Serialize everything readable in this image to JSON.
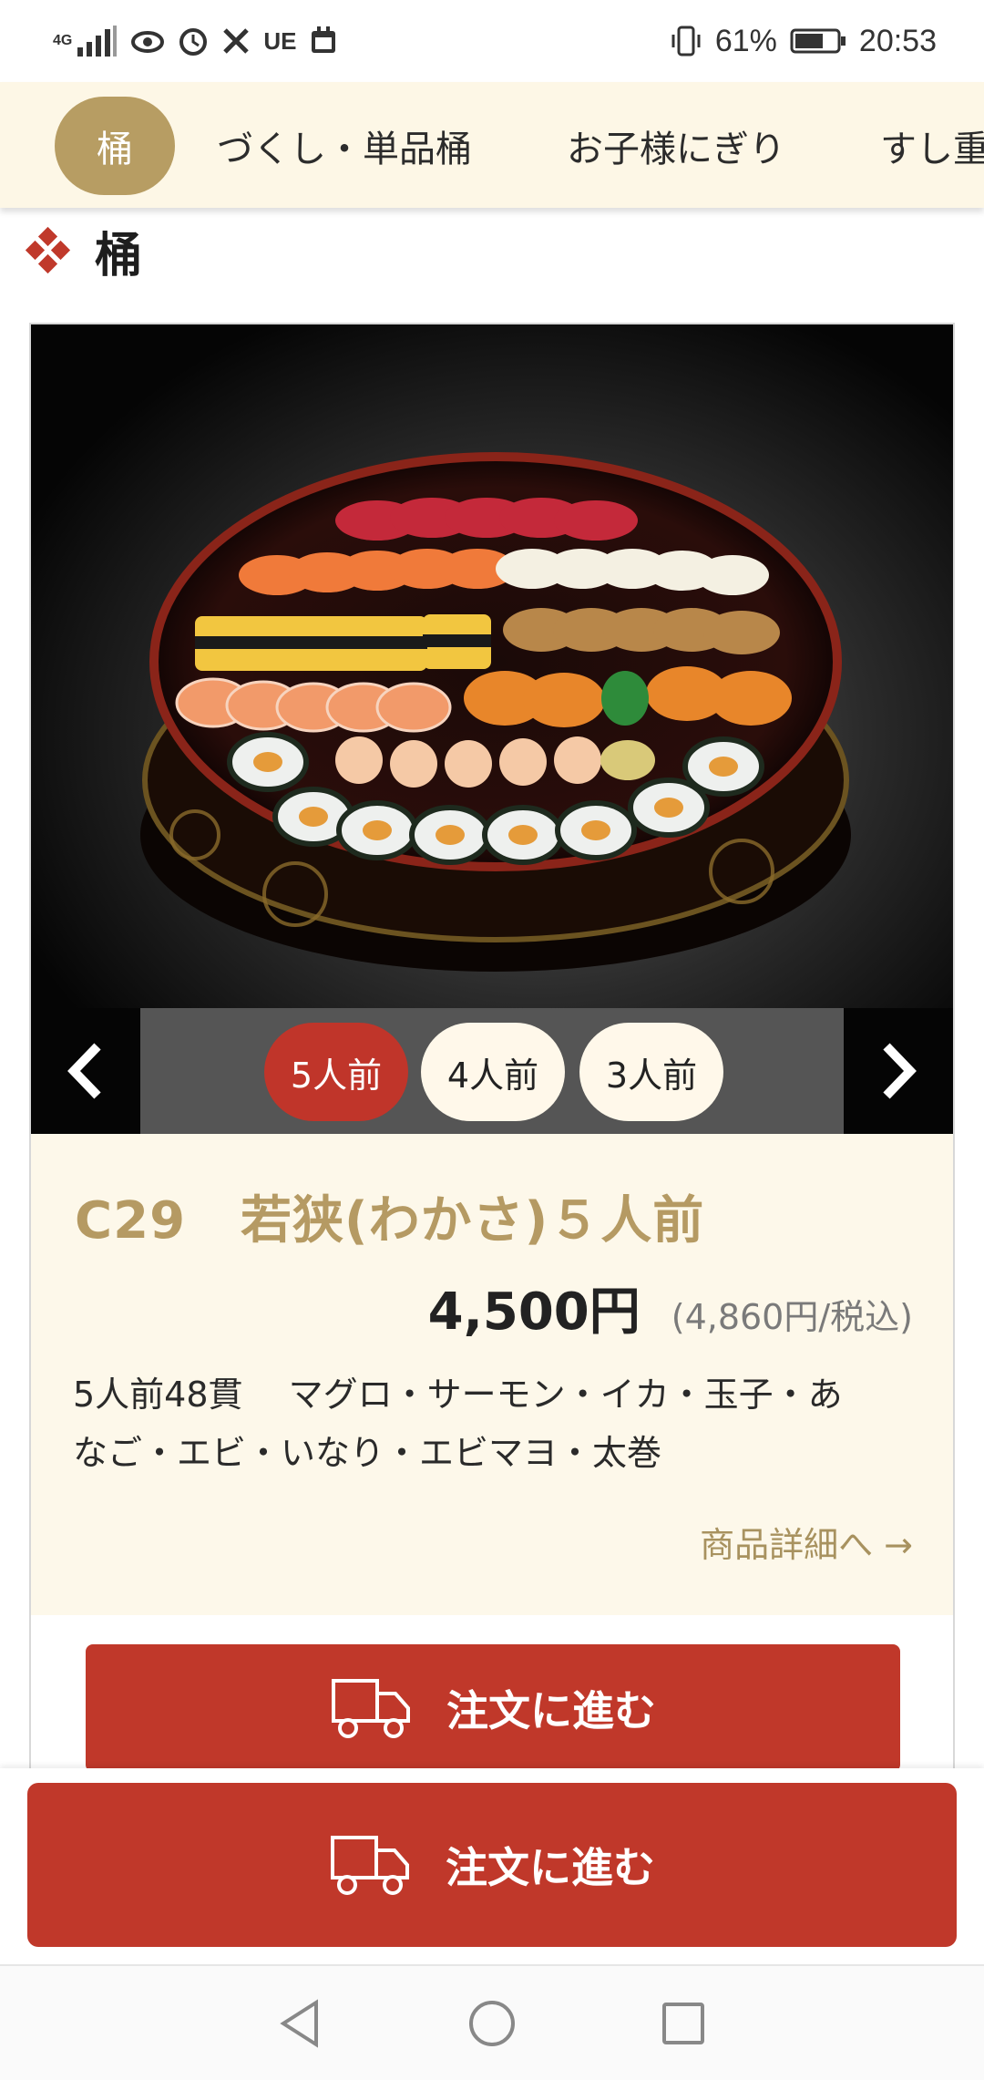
{
  "status_bar": {
    "network": "4G",
    "carrier_tag": "UE",
    "battery": "61%",
    "time": "20:53",
    "icons": [
      "signal-icon",
      "eye-icon",
      "alarm-icon",
      "tools-icon",
      "calendar-icon",
      "vibrate-icon",
      "battery-icon"
    ]
  },
  "tabs": [
    {
      "label": "桶",
      "active": true
    },
    {
      "label": "づくし・単品桶",
      "active": false
    },
    {
      "label": "お子様にぎり",
      "active": false
    },
    {
      "label": "すし重",
      "active": false
    }
  ],
  "section": {
    "title": "桶"
  },
  "product": {
    "code": "C29",
    "name": "若狭(わかさ)５人前",
    "price": "4,500円",
    "tax_price": "(4,860円/税込)",
    "desc_line1": "5人前48貫　 マグロ・サーモン・イカ・玉子・あ",
    "desc_line2": "なご・エビ・いなり・エビマヨ・太巻",
    "detail_link": "商品詳細へ →",
    "variants": [
      {
        "label": "5人前",
        "active": true
      },
      {
        "label": "4人前",
        "active": false
      },
      {
        "label": "3人前",
        "active": false
      }
    ]
  },
  "order_button": {
    "label": "注文に進む"
  },
  "sticky_order_button": {
    "label": "注文に進む"
  },
  "colors": {
    "accent_red": "#c0382a",
    "gold": "#b59a63",
    "cream": "#fdf8ea"
  }
}
